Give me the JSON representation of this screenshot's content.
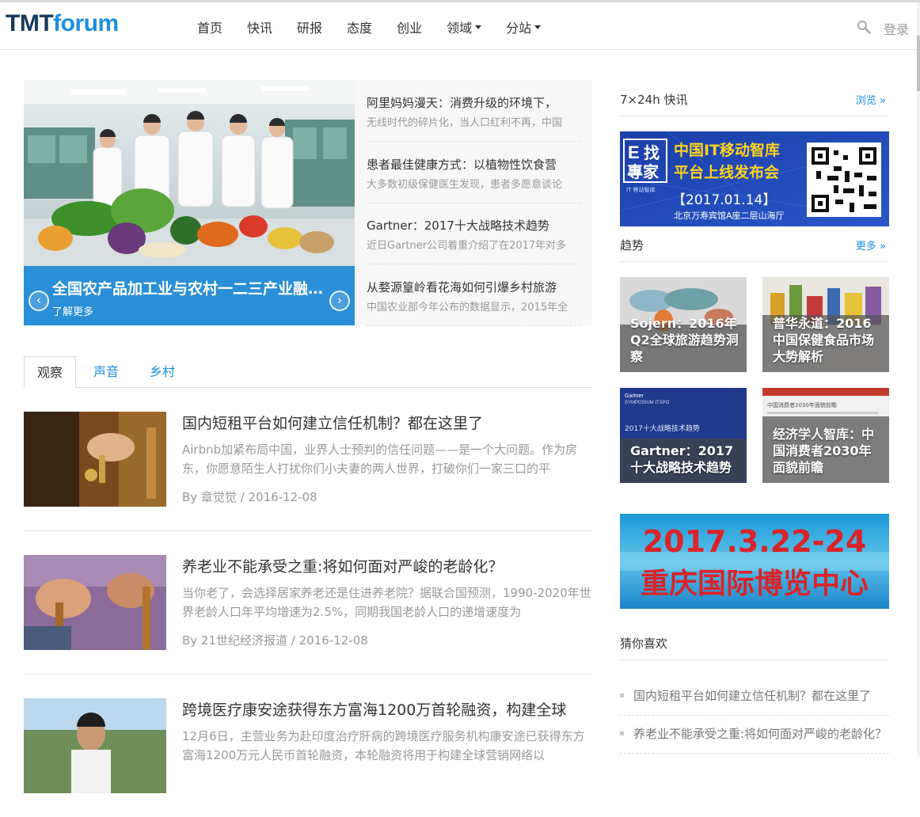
{
  "header": {
    "logo_part1": "TMT",
    "logo_part2": "forum",
    "nav": [
      {
        "label": "首页",
        "dropdown": false
      },
      {
        "label": "快讯",
        "dropdown": false
      },
      {
        "label": "研报",
        "dropdown": false
      },
      {
        "label": "态度",
        "dropdown": false
      },
      {
        "label": "创业",
        "dropdown": false
      },
      {
        "label": "领域",
        "dropdown": true
      },
      {
        "label": "分站",
        "dropdown": true
      }
    ],
    "search_icon": "search-icon",
    "login": "登录"
  },
  "slider": {
    "title": "全国农产品加工业与农村一二三产业融合发展",
    "more": "了解更多",
    "prev_icon": "‹",
    "next_icon": "›"
  },
  "headlines": [
    {
      "title": "阿里妈妈漫天：消费升级的环境下，",
      "desc": "无线时代的碎片化，当人口红利不再，中国"
    },
    {
      "title": "患者最佳健康方式：以植物性饮食营",
      "desc": "大多数初级保健医生发现，患者多愿意谈论"
    },
    {
      "title": "Gartner：2017十大战略技术趋势",
      "desc": "近日Gartner公司着重介绍了在2017年对多"
    },
    {
      "title": "从婺源篁岭看花海如何引爆乡村旅游",
      "desc": "中国农业部今年公布的数据显示，2015年全"
    }
  ],
  "tabs": [
    "观察",
    "声音",
    "乡村"
  ],
  "articles": [
    {
      "title": "国内短租平台如何建立信任机制？都在这里了",
      "desc": "Airbnb加紧布局中国，业界人士预判的信任问题——是一个大问题。作为房东，你愿意陌生人打扰你们小夫妻的两人世界，打破你们一家三口的平",
      "meta": "By 章觉觉 / 2016-12-08"
    },
    {
      "title": "养老业不能承受之重:将如何面对严峻的老龄化？",
      "desc": "当你老了，会选择居家养老还是住进养老院？据联合国预测，1990-2020年世界老龄人口年平均增速为2.5%，同期我国老龄人口的递增速度为",
      "meta": "By 21世纪经济报道 / 2016-12-08"
    },
    {
      "title": "跨境医疗康安途获得东方富海1200万首轮融资，构建全球",
      "desc": "12月6日，主营业务为赴印度治疗肝病的跨境医疗服务机构康安途已获得东方富海1200万元人民币首轮融资，本轮融资将用于构建全球营销网络以",
      "meta": ""
    }
  ],
  "sidebar": {
    "flash_title": "7×24h 快讯",
    "flash_more": "浏览 »",
    "banner1": {
      "logo_e": "E",
      "logo_cn1": "找",
      "logo_cn2": "專家",
      "logo_small": "IT 移动智库",
      "line1": "中国IT移动智库",
      "line2": "平台上线发布会",
      "date": "【2017.01.14】",
      "place": "北京万寿宾馆A座二层山海厅"
    },
    "trend_title": "趋势",
    "trend_more": "更多 »",
    "trends": [
      {
        "caption": "Sojern：2016年Q2全球旅游趋势洞察"
      },
      {
        "caption": "普华永道：2016中国保健食品市场大势解析"
      },
      {
        "caption": "Gartner：2017十大战略技术趋势",
        "img_label1": "Gartner",
        "img_label2": "SYMPOSIUM ITXPO",
        "img_label3": "2017十大战略技术趋势"
      },
      {
        "caption": "经济学人智库：中国消费者2030年面貌前瞻",
        "img_label1": "中国消费者2030年面貌前瞻"
      }
    ],
    "banner2": {
      "line1": "2017.3.22-24",
      "line2": "重庆国际博览中心"
    },
    "guess_title": "猜你喜欢",
    "guess": [
      "国内短租平台如何建立信任机制？都在这里了",
      "养老业不能承受之重:将如何面对严峻的老龄化？"
    ]
  },
  "colors": {
    "accent": "#1a8fe0",
    "logo_dark": "#16385f",
    "caption_bg": "#2a8fd6"
  }
}
